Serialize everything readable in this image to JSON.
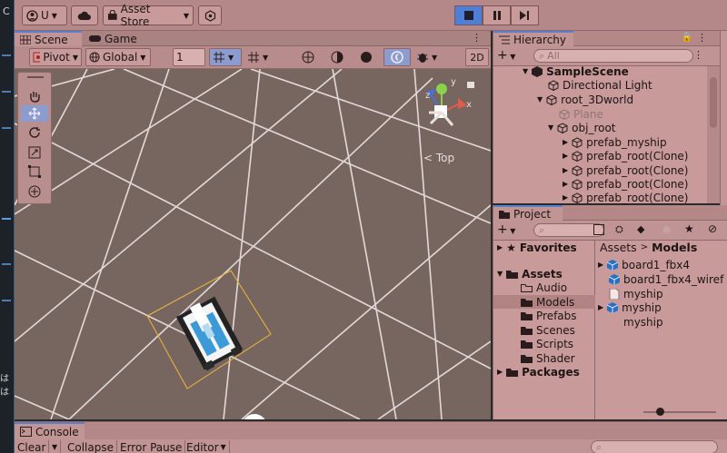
{
  "toolbar": {
    "account_label": "U",
    "asset_store_label": "Asset Store"
  },
  "scene": {
    "tabs": [
      {
        "label": "Scene"
      },
      {
        "label": "Game"
      }
    ],
    "pivot_label": "Pivot",
    "global_label": "Global",
    "grid_value": "1",
    "mode_2d_label": "2D",
    "top_label": "< Top",
    "axes": {
      "y": "y",
      "z": "z",
      "x": "x"
    }
  },
  "hierarchy": {
    "tab_label": "Hierarchy",
    "search_placeholder": "All",
    "items": [
      {
        "label": "SampleScene"
      },
      {
        "label": "Directional Light"
      },
      {
        "label": "root_3Dworld"
      },
      {
        "label": "Plane"
      },
      {
        "label": "obj_root"
      },
      {
        "label": "prefab_myship"
      },
      {
        "label": "prefab_root(Clone)"
      },
      {
        "label": "prefab_root(Clone)"
      },
      {
        "label": "prefab_root(Clone)"
      },
      {
        "label": "prefab_root(Clone)"
      }
    ]
  },
  "project": {
    "tab_label": "Project",
    "tree": [
      {
        "label": "Favorites"
      },
      {
        "label": "Assets"
      },
      {
        "label": "Audio"
      },
      {
        "label": "Models"
      },
      {
        "label": "Prefabs"
      },
      {
        "label": "Scenes"
      },
      {
        "label": "Scripts"
      },
      {
        "label": "Shader"
      },
      {
        "label": "Packages"
      }
    ],
    "breadcrumb": {
      "root": "Assets",
      "current": "Models"
    },
    "files": [
      {
        "label": "board1_fbx4"
      },
      {
        "label": "board1_fbx4_wiref"
      },
      {
        "label": "myship"
      },
      {
        "label": "myship"
      },
      {
        "label": "myship"
      }
    ]
  },
  "console": {
    "tab_label": "Console",
    "clear_label": "Clear",
    "collapse_label": "Collapse",
    "error_pause_label": "Error Pause",
    "editor_label": "Editor"
  },
  "side_text": {
    "top": "C",
    "bottom": "はは"
  }
}
